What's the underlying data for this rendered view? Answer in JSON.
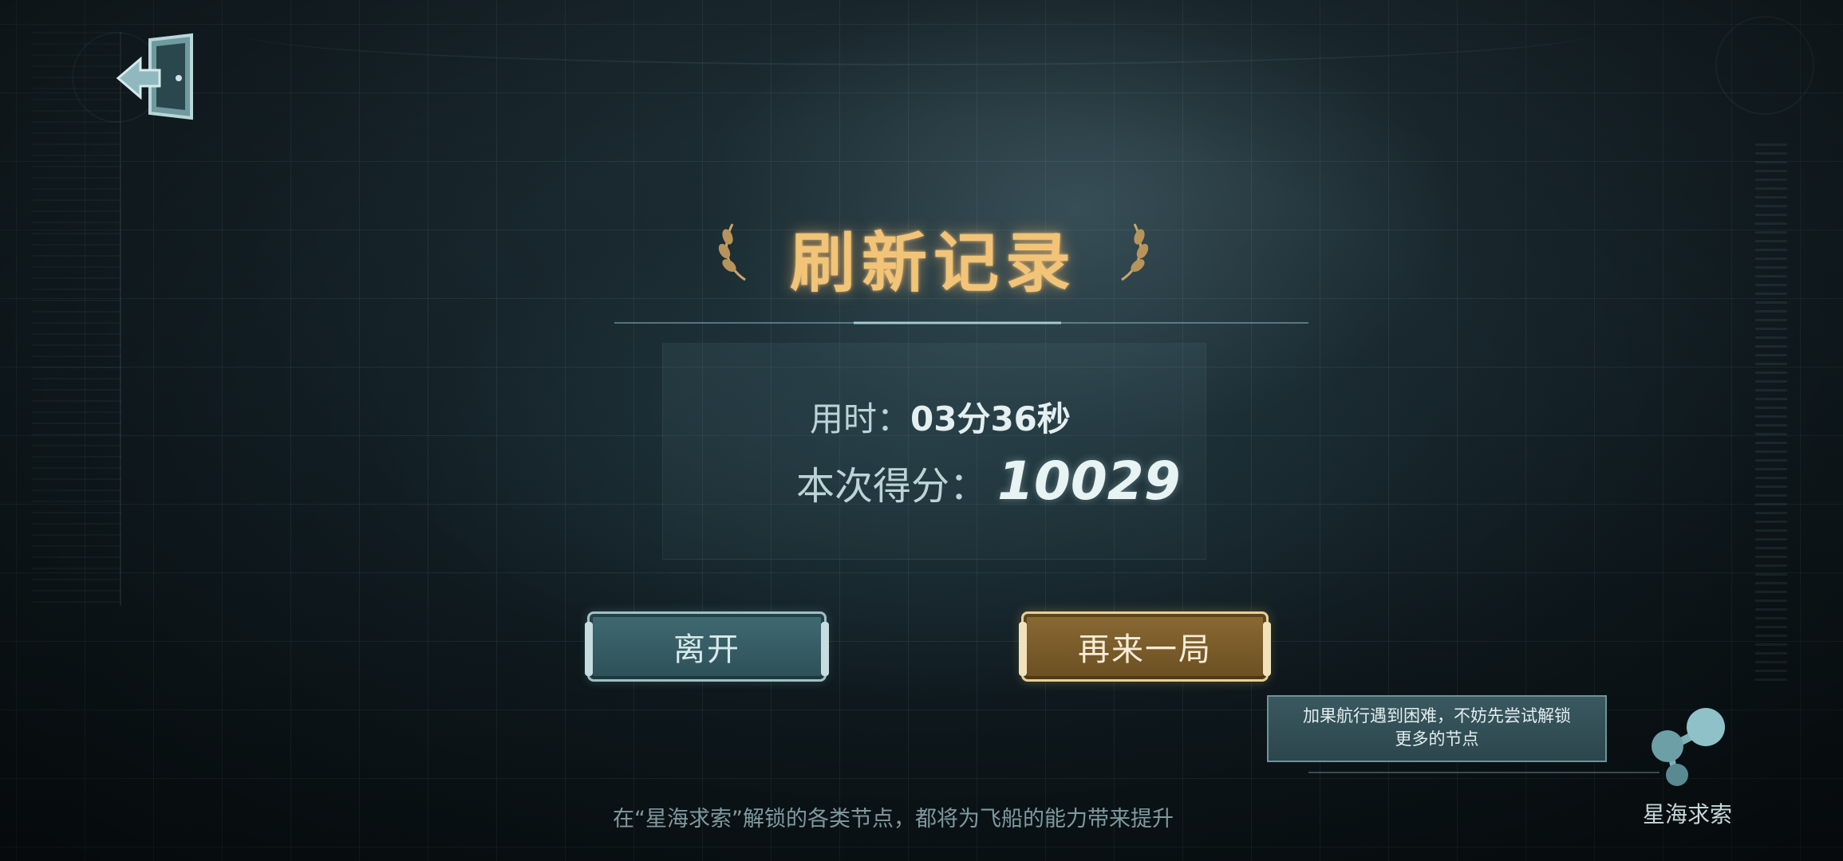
{
  "result": {
    "title": "刷新记录",
    "time_label": "用时：",
    "time_value": "03分36秒",
    "score_label": "本次得分：",
    "score_value": "10029"
  },
  "buttons": {
    "leave_label": "离开",
    "again_label": "再来一局"
  },
  "tooltip": {
    "line1": "加果航行遇到困难，不妨先尝试解锁",
    "line2": "更多的节点"
  },
  "bottom_hint": "在“星海求索”解锁的各类节点，都将为飞船的能力带来提升",
  "starsea": {
    "label": "星海求索"
  },
  "icons": {
    "exit": "exit-door-icon",
    "laurel": "laurel-icon",
    "starsea": "molecule-icon"
  },
  "colors": {
    "title_gold": "#f2c477",
    "leave_button": "#3f6a72",
    "again_button": "#8a6a33"
  }
}
